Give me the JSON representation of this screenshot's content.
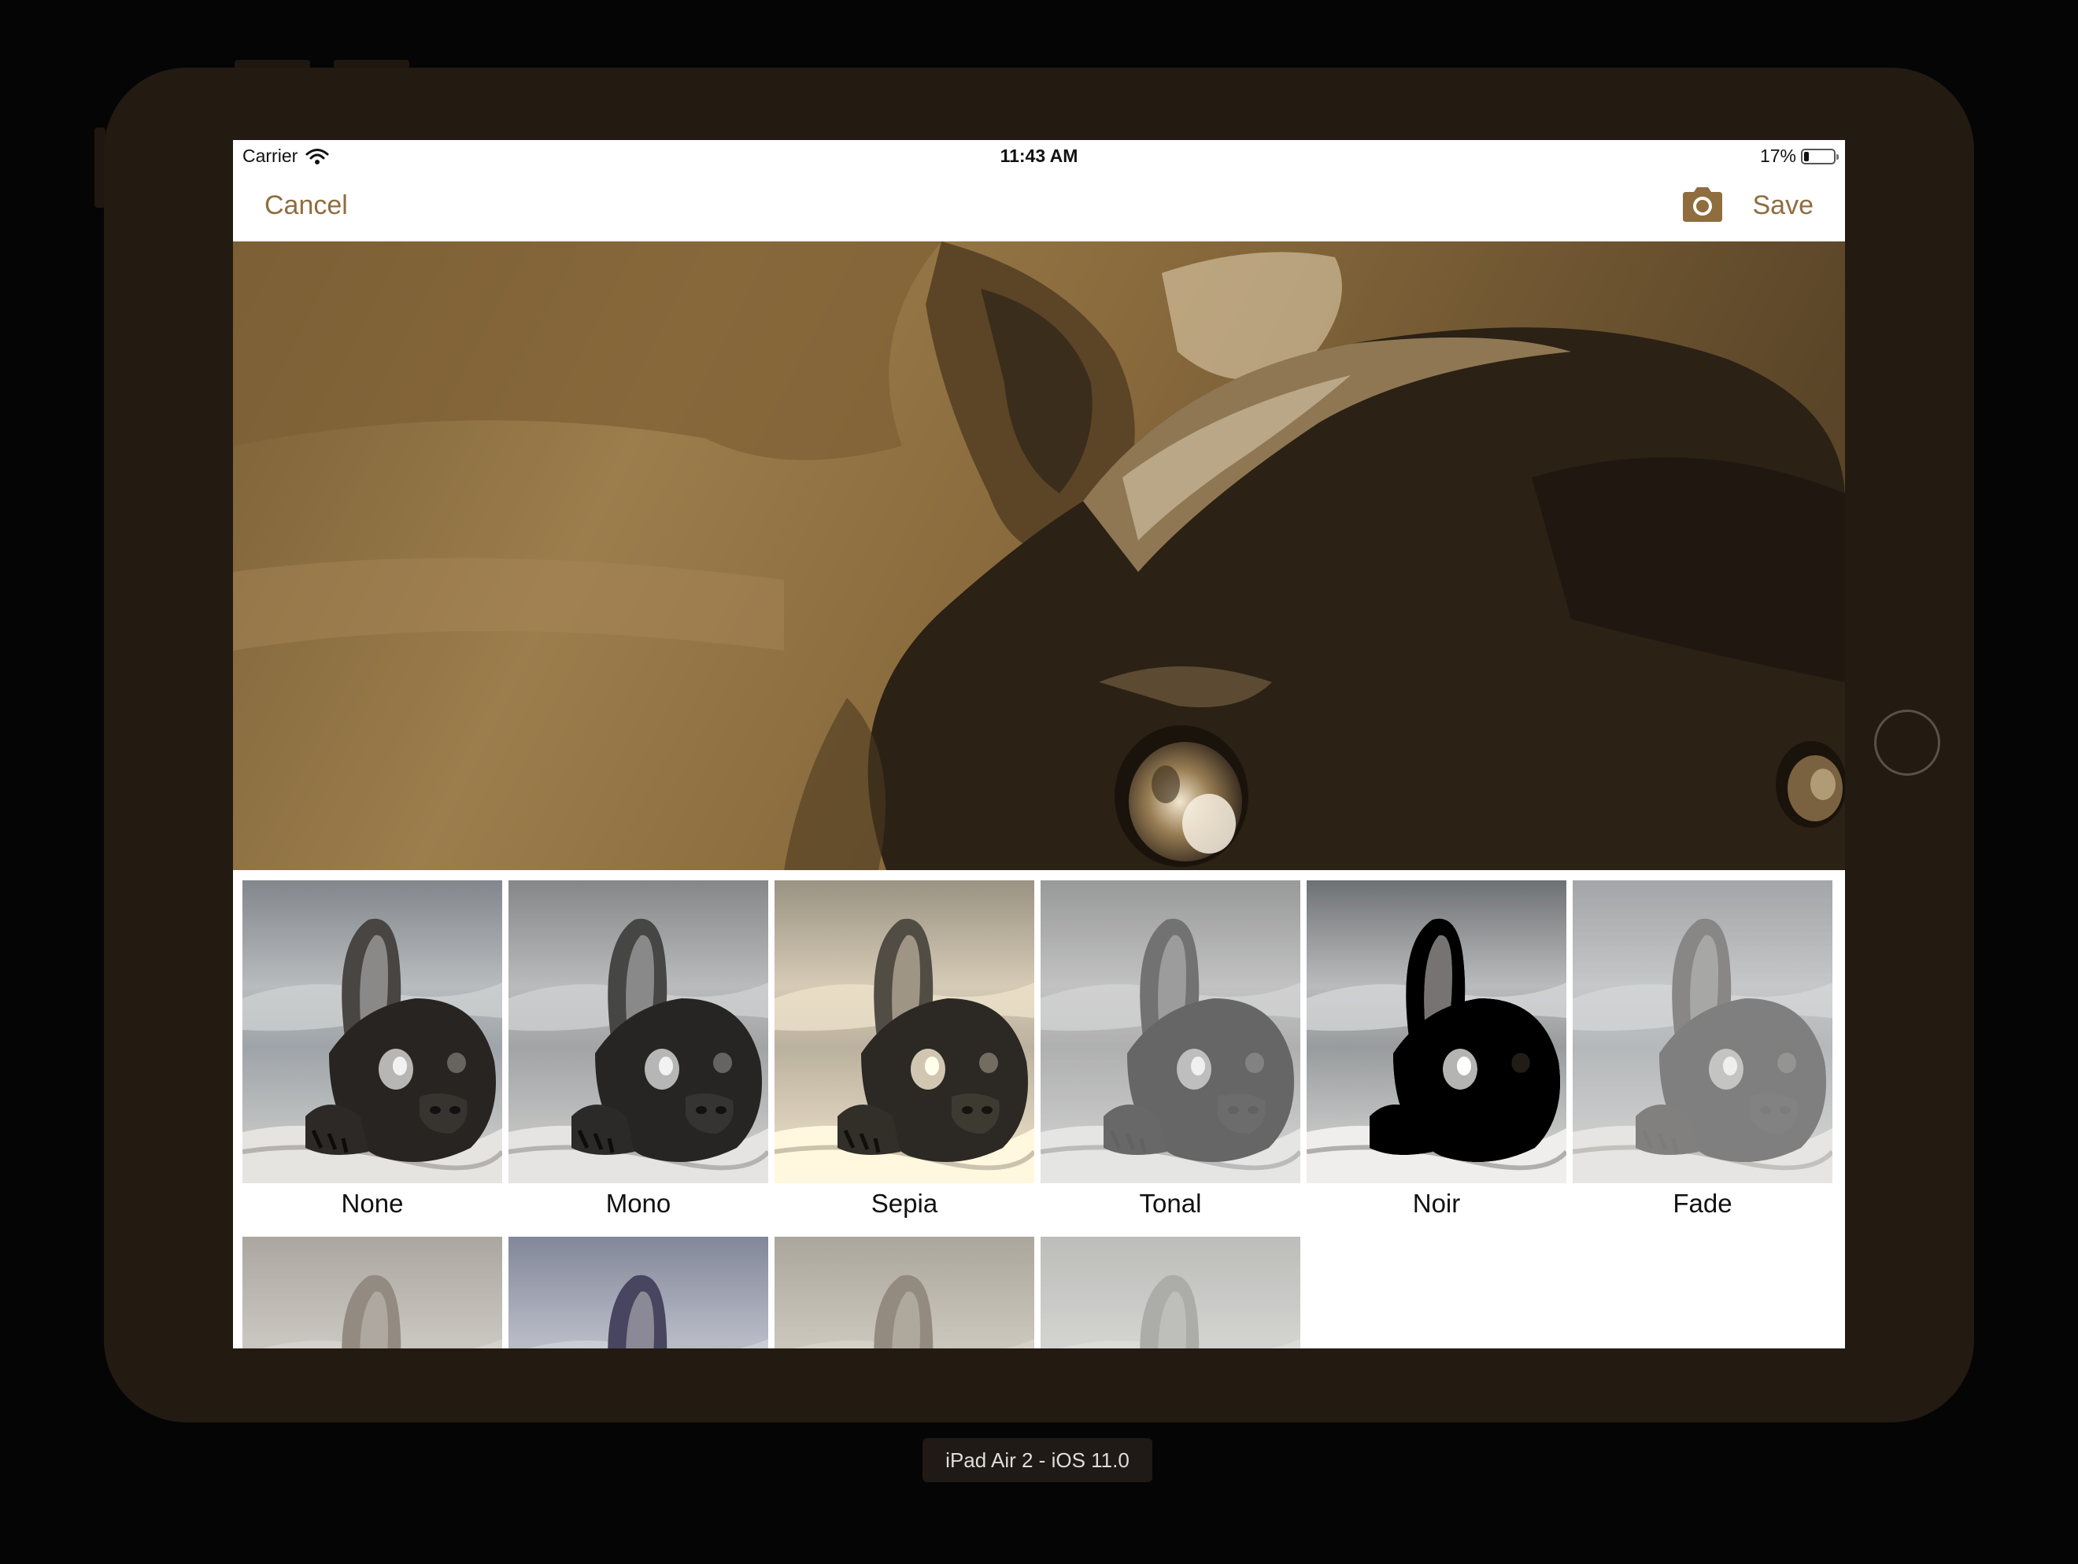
{
  "status_bar": {
    "carrier": "Carrier",
    "time": "11:43 AM",
    "battery_text": "17%",
    "battery_level": 0.17
  },
  "nav": {
    "cancel_label": "Cancel",
    "save_label": "Save",
    "camera_icon": "camera-icon"
  },
  "filters": [
    {
      "label": "None",
      "style": "none"
    },
    {
      "label": "Mono",
      "style": "mono"
    },
    {
      "label": "Sepia",
      "style": "sepia"
    },
    {
      "label": "Tonal",
      "style": "tonal"
    },
    {
      "label": "Noir",
      "style": "noir"
    },
    {
      "label": "Fade",
      "style": "fade"
    },
    {
      "label": "",
      "style": "chrome"
    },
    {
      "label": "",
      "style": "process"
    },
    {
      "label": "",
      "style": "transfer"
    },
    {
      "label": "",
      "style": "instant"
    }
  ],
  "device_caption": "iPad Air 2 - iOS 11.0",
  "colors": {
    "accent": "#8f6d3f",
    "device_frame": "#231a12"
  }
}
